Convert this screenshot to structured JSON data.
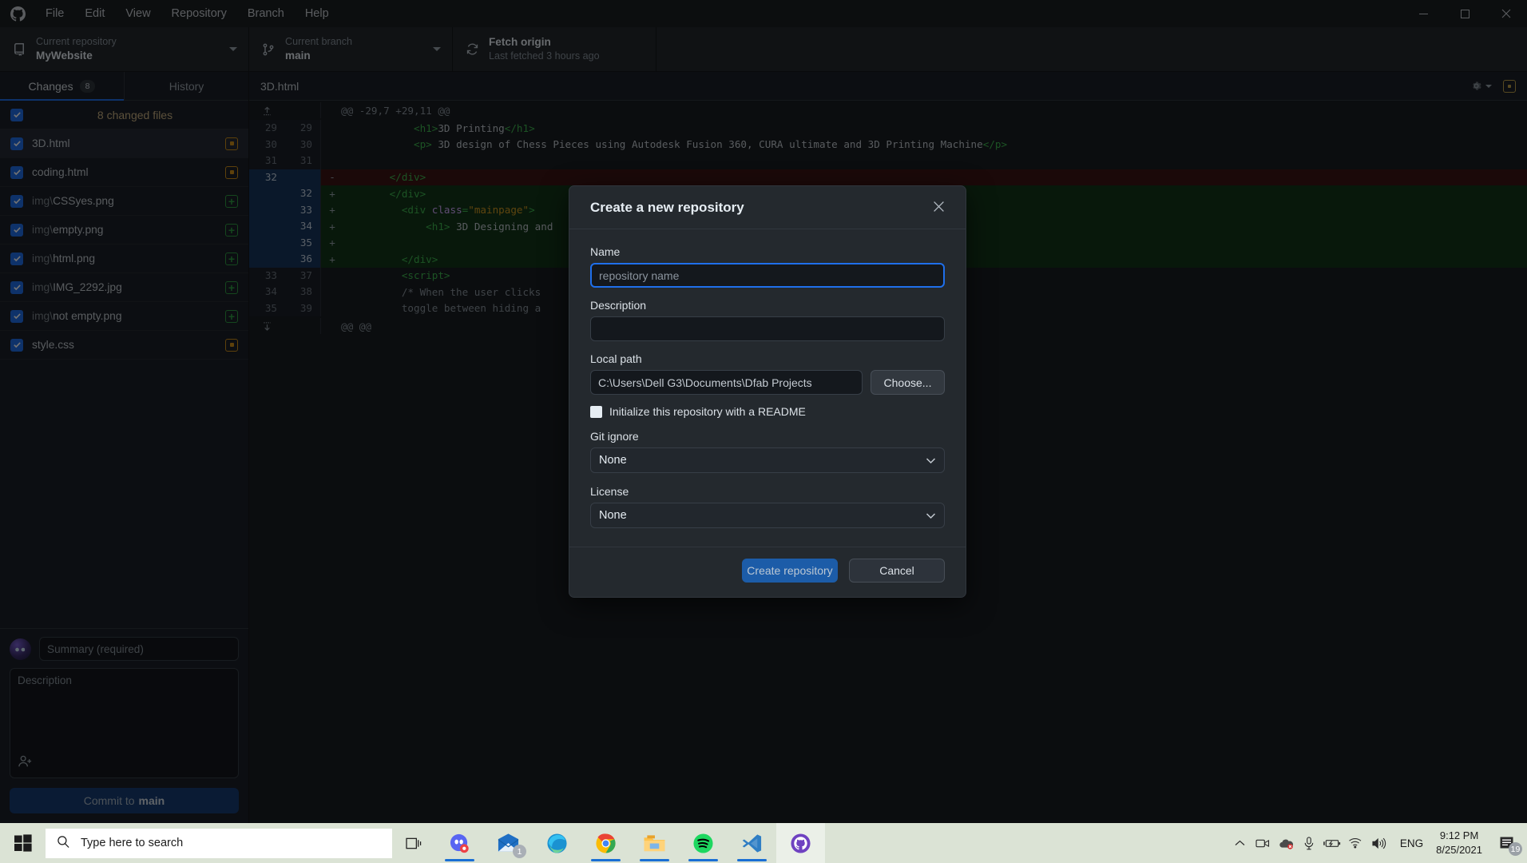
{
  "titlebar": {
    "logo_icon": "github-logo-icon",
    "menus": [
      "File",
      "Edit",
      "View",
      "Repository",
      "Branch",
      "Help"
    ],
    "minimize_icon": "minimize-icon",
    "maximize_icon": "maximize-icon",
    "close_icon": "close-icon"
  },
  "toolbar": {
    "repository": {
      "label": "Current repository",
      "value": "MyWebsite",
      "icon": "repo-icon"
    },
    "branch": {
      "label": "Current branch",
      "value": "main",
      "icon": "branch-icon"
    },
    "fetch": {
      "label": "Fetch origin",
      "value": "Last fetched 3 hours ago",
      "icon": "sync-icon"
    }
  },
  "sidebar": {
    "tabs": [
      {
        "label": "Changes",
        "badge": "8",
        "active": true
      },
      {
        "label": "History",
        "badge": "",
        "active": false
      }
    ],
    "all_row": {
      "label": "8 changed files",
      "checked": true
    },
    "files": [
      {
        "dir": "",
        "name": "3D.html",
        "status": "modified",
        "checked": true,
        "selected": true
      },
      {
        "dir": "",
        "name": "coding.html",
        "status": "modified",
        "checked": true,
        "selected": false
      },
      {
        "dir": "img\\",
        "name": "CSSyes.png",
        "status": "new",
        "checked": true,
        "selected": false
      },
      {
        "dir": "img\\",
        "name": "empty.png",
        "status": "new",
        "checked": true,
        "selected": false
      },
      {
        "dir": "img\\",
        "name": "html.png",
        "status": "new",
        "checked": true,
        "selected": false
      },
      {
        "dir": "img\\",
        "name": "IMG_2292.jpg",
        "status": "new",
        "checked": true,
        "selected": false
      },
      {
        "dir": "img\\",
        "name": "not empty.png",
        "status": "new",
        "checked": true,
        "selected": false
      },
      {
        "dir": "",
        "name": "style.css",
        "status": "modified",
        "checked": true,
        "selected": false
      }
    ],
    "commit": {
      "summary_placeholder": "Summary (required)",
      "description_placeholder": "Description",
      "coauthor_icon": "add-coauthor-icon",
      "button_prefix": "Commit to",
      "button_branch": "main"
    }
  },
  "main": {
    "file_header": {
      "filename": "3D.html",
      "settings_icon": "gear-icon",
      "discard_icon": "undo-icon"
    },
    "diff": {
      "hunk_header_top": "@@ -29,7 +29,11 @@",
      "hunk_header_bottom": "@@ @@",
      "expand_up_icon": "expand-up-icon",
      "expand_down_icon": "expand-down-icon",
      "lines": [
        {
          "old": "29",
          "new": "29",
          "sign": "",
          "type": "ctx",
          "text": "            <h1>3D Printing</h1>"
        },
        {
          "old": "30",
          "new": "30",
          "sign": "",
          "type": "ctx",
          "text": "            <p> 3D design of Chess Pieces using Autodesk Fusion 360, CURA ultimate and 3D Printing Machine</p>"
        },
        {
          "old": "31",
          "new": "31",
          "sign": "",
          "type": "ctx",
          "text": ""
        },
        {
          "old": "32",
          "new": "",
          "sign": "-",
          "type": "del",
          "text": "        </div>"
        },
        {
          "old": "",
          "new": "32",
          "sign": "+",
          "type": "add",
          "text": "        </div>"
        },
        {
          "old": "",
          "new": "33",
          "sign": "+",
          "type": "add",
          "text": "      <div class=\"mainpage\">"
        },
        {
          "old": "",
          "new": "34",
          "sign": "+",
          "type": "add",
          "text": "          <h1> 3D Designing and "
        },
        {
          "old": "",
          "new": "35",
          "sign": "+",
          "type": "add",
          "text": ""
        },
        {
          "old": "",
          "new": "36",
          "sign": "+",
          "type": "add",
          "text": "      </div>"
        },
        {
          "old": "33",
          "new": "37",
          "sign": "",
          "type": "ctx",
          "text": "      <script>"
        },
        {
          "old": "34",
          "new": "38",
          "sign": "",
          "type": "ctx",
          "text": "          /* When the user clicks "
        },
        {
          "old": "35",
          "new": "39",
          "sign": "",
          "type": "ctx",
          "text": "          toggle between hiding a"
        }
      ]
    }
  },
  "modal": {
    "title": "Create a new repository",
    "close_icon": "close-icon",
    "name": {
      "label": "Name",
      "value": "",
      "placeholder": "repository name"
    },
    "description": {
      "label": "Description",
      "value": "",
      "placeholder": ""
    },
    "local_path": {
      "label": "Local path",
      "value": "C:\\Users\\Dell G3\\Documents\\Dfab Projects",
      "choose_label": "Choose..."
    },
    "readme": {
      "label": "Initialize this repository with a README",
      "checked": false
    },
    "gitignore": {
      "label": "Git ignore",
      "value": "None"
    },
    "license": {
      "label": "License",
      "value": "None"
    },
    "create_label": "Create repository",
    "cancel_label": "Cancel"
  },
  "taskbar": {
    "start_icon": "windows-start-icon",
    "search": {
      "placeholder": "Type here to search",
      "icon": "search-icon"
    },
    "task_view_icon": "task-view-icon",
    "apps": [
      {
        "name": "discord-icon",
        "running": true,
        "active": false,
        "badge": ""
      },
      {
        "name": "mail-icon",
        "running": false,
        "active": false,
        "badge": "1"
      },
      {
        "name": "edge-icon",
        "running": false,
        "active": false,
        "badge": ""
      },
      {
        "name": "chrome-icon",
        "running": true,
        "active": false,
        "badge": ""
      },
      {
        "name": "file-explorer-icon",
        "running": true,
        "active": false,
        "badge": ""
      },
      {
        "name": "spotify-icon",
        "running": true,
        "active": false,
        "badge": ""
      },
      {
        "name": "vscode-icon",
        "running": true,
        "active": false,
        "badge": ""
      },
      {
        "name": "github-desktop-icon",
        "running": true,
        "active": true,
        "badge": ""
      }
    ],
    "tray": {
      "chevron_icon": "show-hidden-icons-icon",
      "icons": [
        "camera-icon",
        "onedrive-offline-icon",
        "microphone-icon",
        "battery-charging-icon",
        "wifi-icon",
        "volume-icon"
      ],
      "language": "ENG",
      "time": "9:12 PM",
      "date": "8/25/2021",
      "notifications_icon": "action-center-icon",
      "notifications_count": "19"
    }
  },
  "colors": {
    "accent_blue": "#1f6feb",
    "add_green": "#13351a",
    "del_red": "#3d1416",
    "modified_amber": "#d0901a",
    "new_green": "#2f9e44",
    "taskbar_bg": "#dbe3d5"
  }
}
